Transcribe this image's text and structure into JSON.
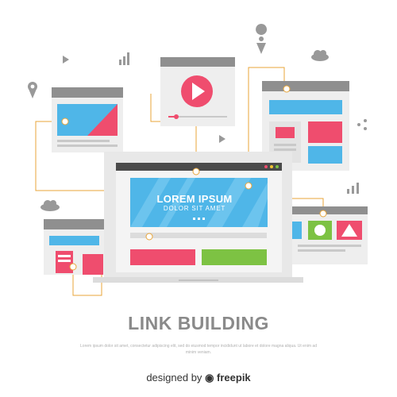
{
  "hero": {
    "title": "LOREM IPSUM",
    "subtitle": "DOLOR SIT AMET"
  },
  "main_title": "LINK BUILDING",
  "body_text": "Lorem ipsum dolor sit amet, consectetur adipiscing elit, sed do eiusmod tempor incididunt ut labore et dolore magna aliqua. Ut enim ad minim veniam.",
  "credit": {
    "prefix": "designed by",
    "brand": "freepik"
  },
  "colors": {
    "frame_gray": "#8f8f8f",
    "panel_light": "#eeeeee",
    "screen_blue": "#4fb6e8",
    "accent_pink": "#ef4d6e",
    "accent_green": "#7dc243",
    "link_orange": "#e8a53a"
  }
}
